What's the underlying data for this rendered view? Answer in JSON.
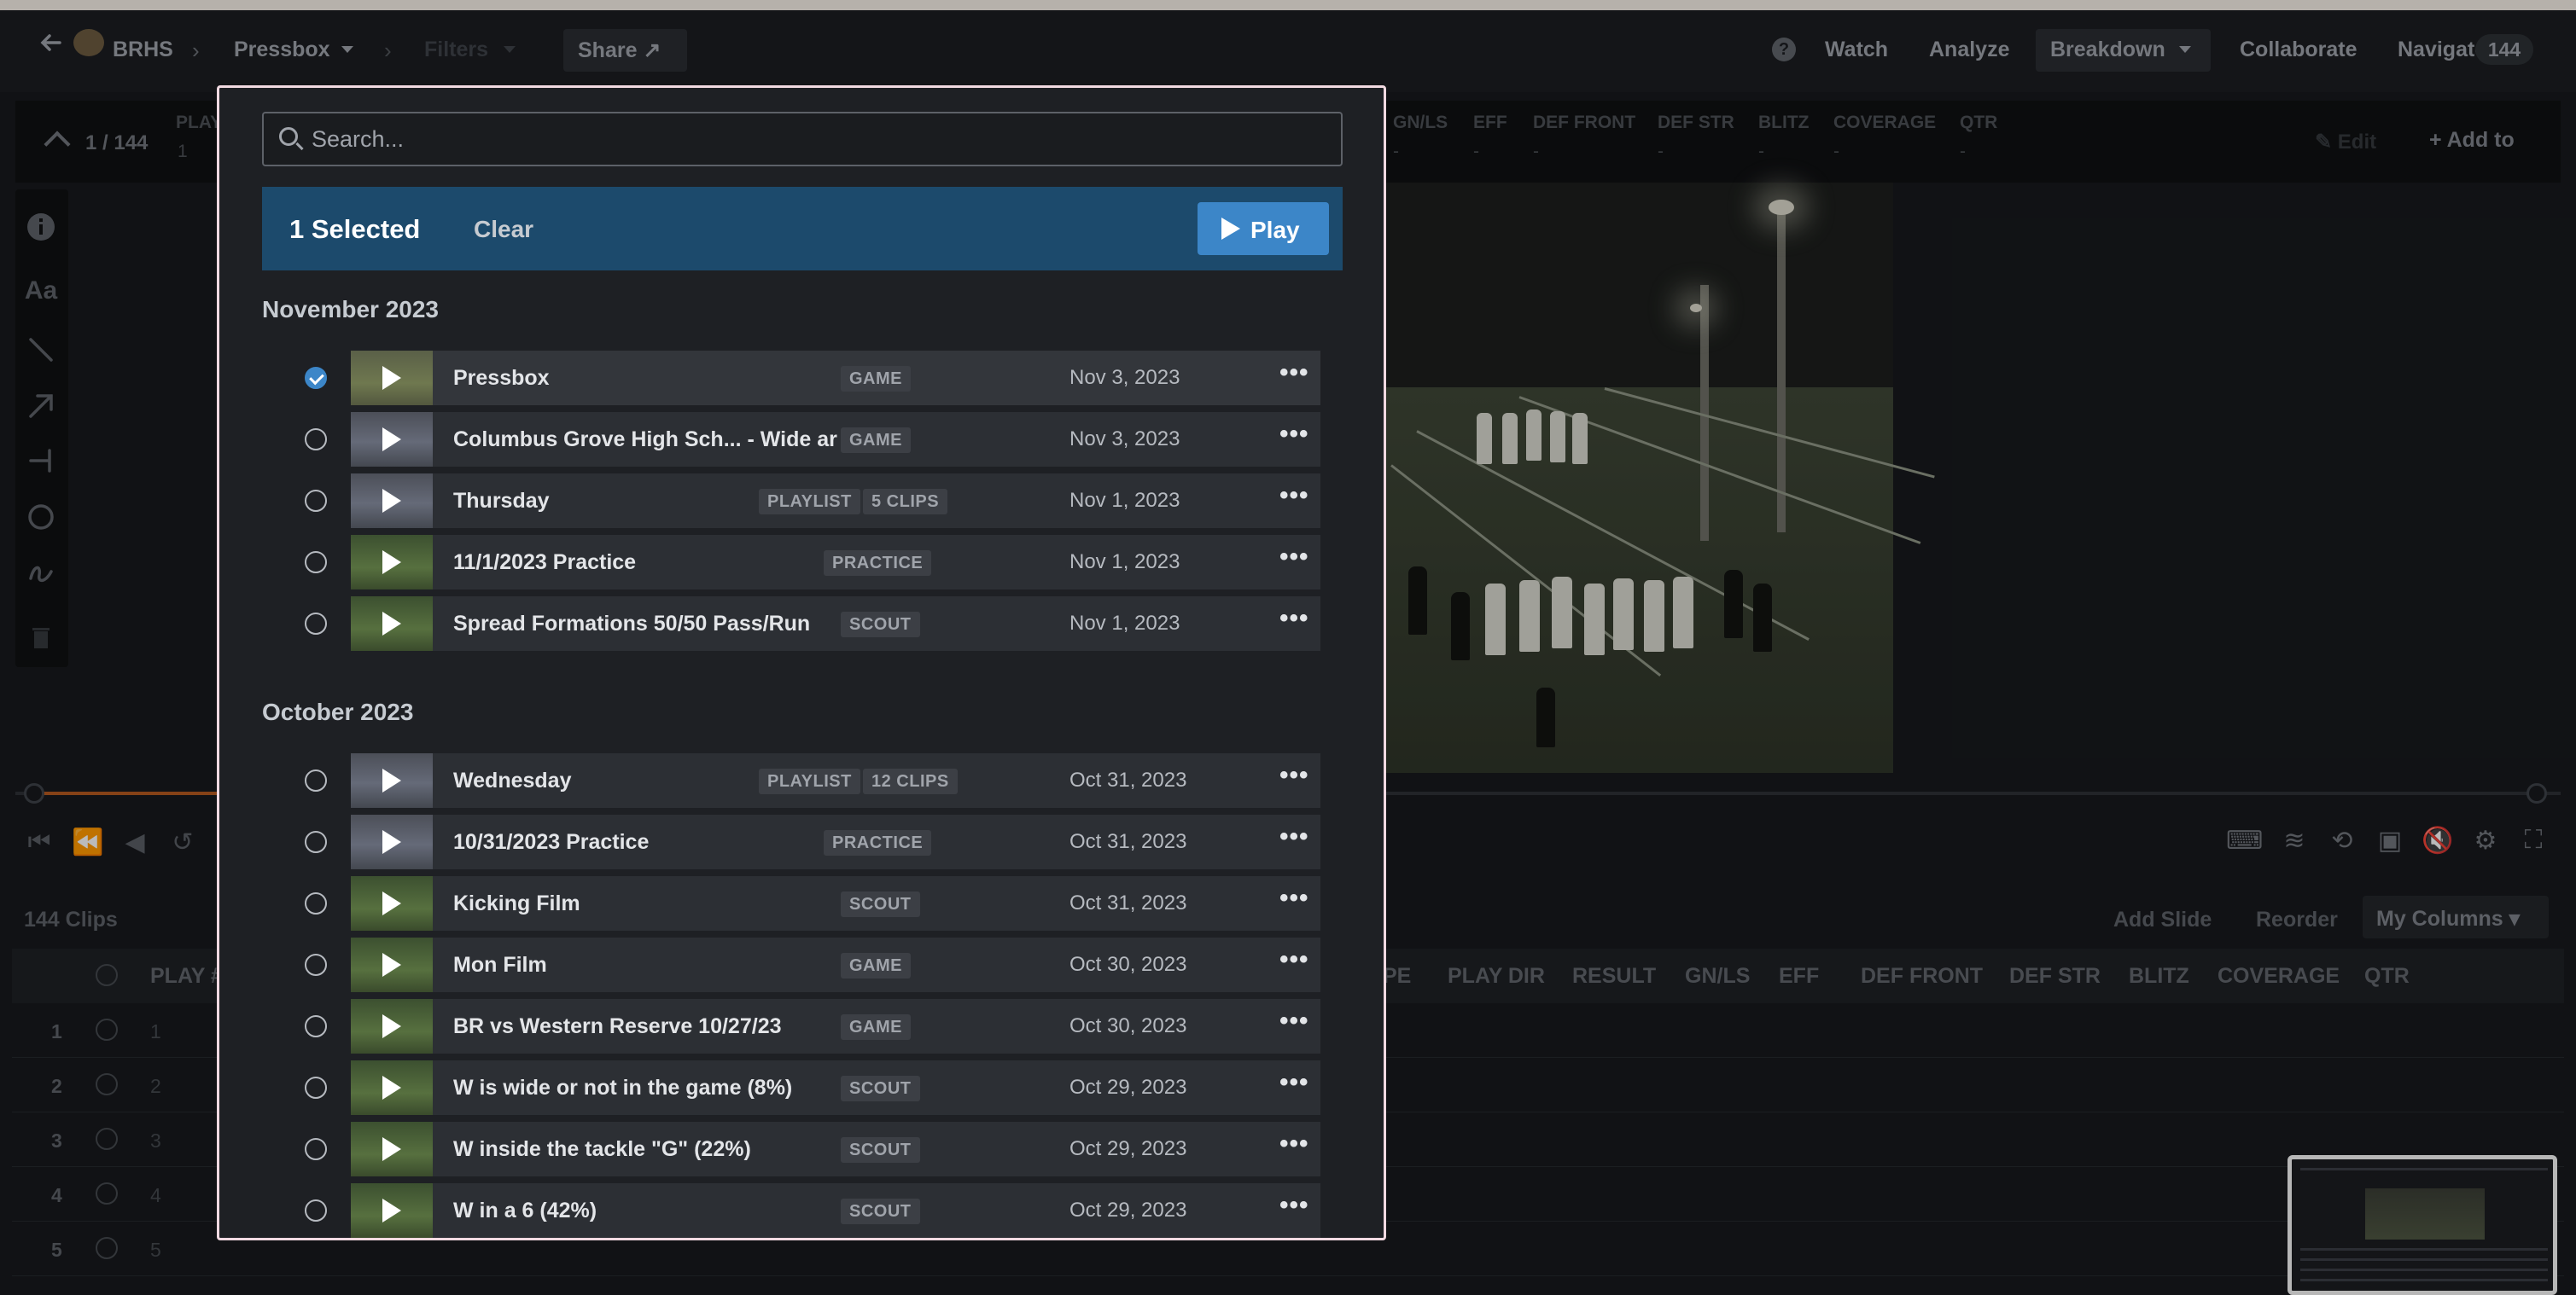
{
  "topbar": {
    "team": "BRHS",
    "film": "Pressbox",
    "filters": "Filters",
    "share": "Share",
    "help": "?",
    "watch": "Watch",
    "analyze": "Analyze",
    "breakdown": "Breakdown",
    "collaborate": "Collaborate",
    "navigate": "Navigate",
    "navigate_count": "144"
  },
  "play_header": {
    "counter": "1 / 144",
    "play_label": "PLAY",
    "play_value": "1",
    "columns": [
      "GN/LS",
      "EFF",
      "DEF FRONT",
      "DEF STR",
      "BLITZ",
      "COVERAGE",
      "QTR"
    ],
    "dash": "-",
    "edit": "Edit",
    "add_to": "+ Add to"
  },
  "tools": {
    "info": "i",
    "text": "Aa"
  },
  "clips": {
    "title": "144 Clips",
    "add_slide": "Add Slide",
    "reorder": "Reorder",
    "my_columns": "My Columns",
    "columns": [
      "PLAY #",
      "PE",
      "PLAY DIR",
      "RESULT",
      "GN/LS",
      "EFF",
      "DEF FRONT",
      "DEF STR",
      "BLITZ",
      "COVERAGE",
      "QTR"
    ],
    "rows": [
      {
        "num": "1",
        "play": "1"
      },
      {
        "num": "2",
        "play": "2"
      },
      {
        "num": "3",
        "play": "3"
      },
      {
        "num": "4",
        "play": "4"
      },
      {
        "num": "5",
        "play": "5"
      }
    ]
  },
  "modal": {
    "search_placeholder": "Search...",
    "selected_text": "1 Selected",
    "clear": "Clear",
    "play": "Play",
    "groups": [
      {
        "month": "November 2023",
        "items": [
          {
            "name": "Pressbox",
            "badges": [
              "GAME"
            ],
            "date": "Nov 3, 2023",
            "selected": true
          },
          {
            "name": "Columbus Grove High Sch... - Wide ar",
            "badges": [
              "GAME"
            ],
            "date": "Nov 3, 2023",
            "selected": false
          },
          {
            "name": "Thursday",
            "badges": [
              "PLAYLIST",
              "5 CLIPS"
            ],
            "date": "Nov 1, 2023",
            "selected": false
          },
          {
            "name": "11/1/2023 Practice",
            "badges": [
              "PRACTICE"
            ],
            "date": "Nov 1, 2023",
            "selected": false
          },
          {
            "name": "Spread Formations 50/50 Pass/Run",
            "badges": [
              "SCOUT"
            ],
            "date": "Nov 1, 2023",
            "selected": false
          }
        ]
      },
      {
        "month": "October 2023",
        "items": [
          {
            "name": "Wednesday",
            "badges": [
              "PLAYLIST",
              "12 CLIPS"
            ],
            "date": "Oct 31, 2023",
            "selected": false
          },
          {
            "name": "10/31/2023 Practice",
            "badges": [
              "PRACTICE"
            ],
            "date": "Oct 31, 2023",
            "selected": false
          },
          {
            "name": "Kicking Film",
            "badges": [
              "SCOUT"
            ],
            "date": "Oct 31, 2023",
            "selected": false
          },
          {
            "name": "Mon Film",
            "badges": [
              "GAME"
            ],
            "date": "Oct 30, 2023",
            "selected": false
          },
          {
            "name": "BR vs Western Reserve 10/27/23",
            "badges": [
              "GAME"
            ],
            "date": "Oct 30, 2023",
            "selected": false
          },
          {
            "name": "W is wide or not in the game (8%)",
            "badges": [
              "SCOUT"
            ],
            "date": "Oct 29, 2023",
            "selected": false
          },
          {
            "name": "W inside the tackle \"G\" (22%)",
            "badges": [
              "SCOUT"
            ],
            "date": "Oct 29, 2023",
            "selected": false
          },
          {
            "name": "W in a 6 (42%)",
            "badges": [
              "SCOUT"
            ],
            "date": "Oct 29, 2023",
            "selected": false
          }
        ]
      }
    ],
    "more_glyph": "•••"
  },
  "colors": {
    "accent": "#3c86c8",
    "selected_bar": "#1c4a6c",
    "modal_border": "#f1d9e1",
    "progress": "#b3591f"
  }
}
